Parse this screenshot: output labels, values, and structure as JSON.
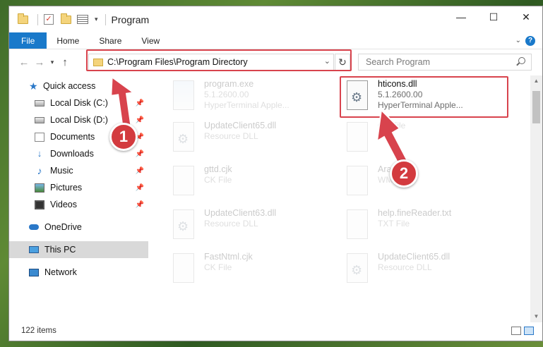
{
  "titlebar": {
    "title": "Program",
    "minimize": "—",
    "maximize": "☐",
    "close": "✕"
  },
  "ribbon": {
    "tabs": [
      "File",
      "Home",
      "Share",
      "View"
    ],
    "help": "?"
  },
  "nav": {
    "back": "←",
    "forward": "→",
    "recent": "▾",
    "up": "↑",
    "address": "C:\\Program Files\\Program Directory",
    "refresh": "↻",
    "search_placeholder": "Search Program"
  },
  "sidebar": {
    "quick_access": "Quick access",
    "items": [
      {
        "label": "Local Disk (C:)",
        "icon": "disk-icon"
      },
      {
        "label": "Local Disk (D:)",
        "icon": "disk-icon"
      },
      {
        "label": "Documents",
        "icon": "documents-icon"
      },
      {
        "label": "Downloads",
        "icon": "downloads-icon"
      },
      {
        "label": "Music",
        "icon": "music-icon"
      },
      {
        "label": "Pictures",
        "icon": "pictures-icon"
      },
      {
        "label": "Videos",
        "icon": "videos-icon"
      }
    ],
    "onedrive": "OneDrive",
    "this_pc": "This PC",
    "network": "Network"
  },
  "files": [
    {
      "name": "program.exe",
      "line2": "5.1.2600.00",
      "line3": "HyperTerminal Apple..."
    },
    {
      "name": "hticons.dll",
      "line2": "5.1.2600.00",
      "line3": "HyperTerminal Apple..."
    },
    {
      "name": "UpdateClient65.dll",
      "line2": "Resource DLL",
      "line3": ""
    },
    {
      "name": "",
      "line2": "CK File",
      "line3": ""
    },
    {
      "name": "gttd.cjk",
      "line2": "CK File",
      "line3": ""
    },
    {
      "name": "Arabic.dll",
      "line2": "WMI",
      "line3": ""
    },
    {
      "name": "UpdateClient63.dll",
      "line2": "Resource DLL",
      "line3": ""
    },
    {
      "name": "help.fineReader.txt",
      "line2": "TXT File",
      "line3": ""
    },
    {
      "name": "FastNtml.cjk",
      "line2": "CK File",
      "line3": ""
    },
    {
      "name": "UpdateClient65.dll",
      "line2": "Resource DLL",
      "line3": ""
    }
  ],
  "status": {
    "count": "122 items"
  },
  "callouts": {
    "one": "1",
    "two": "2"
  },
  "colors": {
    "highlight": "#d8434d",
    "accent": "#1979ca"
  }
}
